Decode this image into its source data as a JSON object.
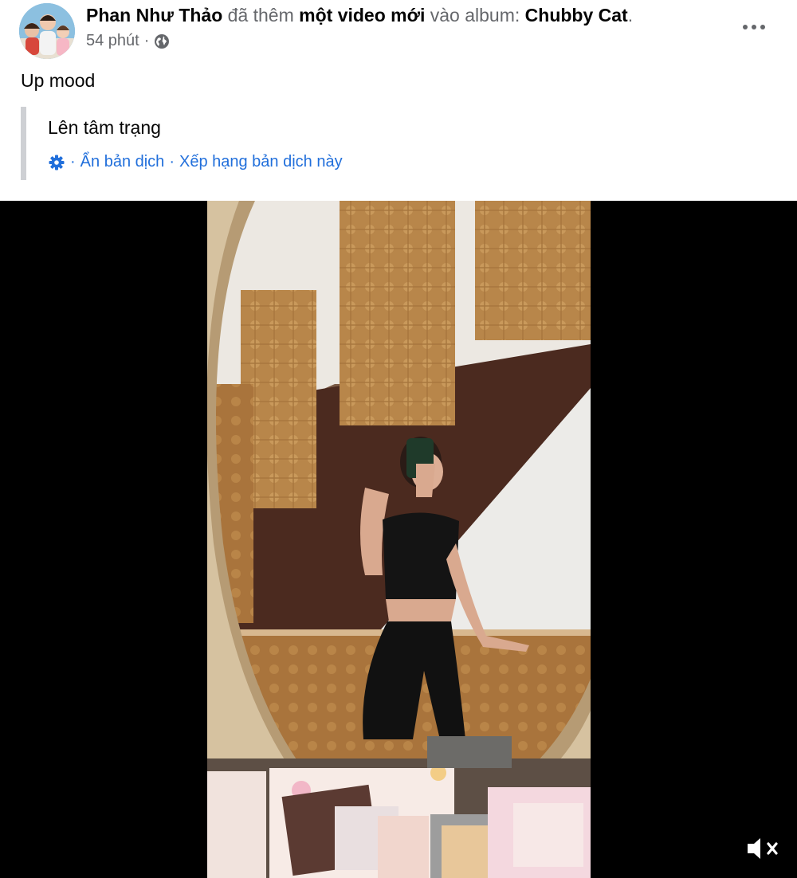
{
  "post": {
    "author": "Phan Như Thảo",
    "action_text": " đã thêm ",
    "object_text": "một video mới",
    "album_prefix": " vào album: ",
    "album_name": "Chubby Cat",
    "album_suffix": ".",
    "time": "54 phút",
    "meta_separator": "·",
    "caption": "Up mood"
  },
  "translation": {
    "text": "Lên tâm trạng",
    "separator": "·",
    "hide_label": "Ẩn bản dịch",
    "rate_label": "Xếp hạng bản dịch này"
  },
  "icons": {
    "avatar": "avatar",
    "privacy": "globe-icon",
    "more": "more-icon",
    "settings": "gear-icon",
    "mute": "muted-speaker-icon"
  },
  "colors": {
    "link": "#216fdb",
    "secondary_text": "#65676b",
    "primary_text": "#050505",
    "video_background": "#000000"
  }
}
